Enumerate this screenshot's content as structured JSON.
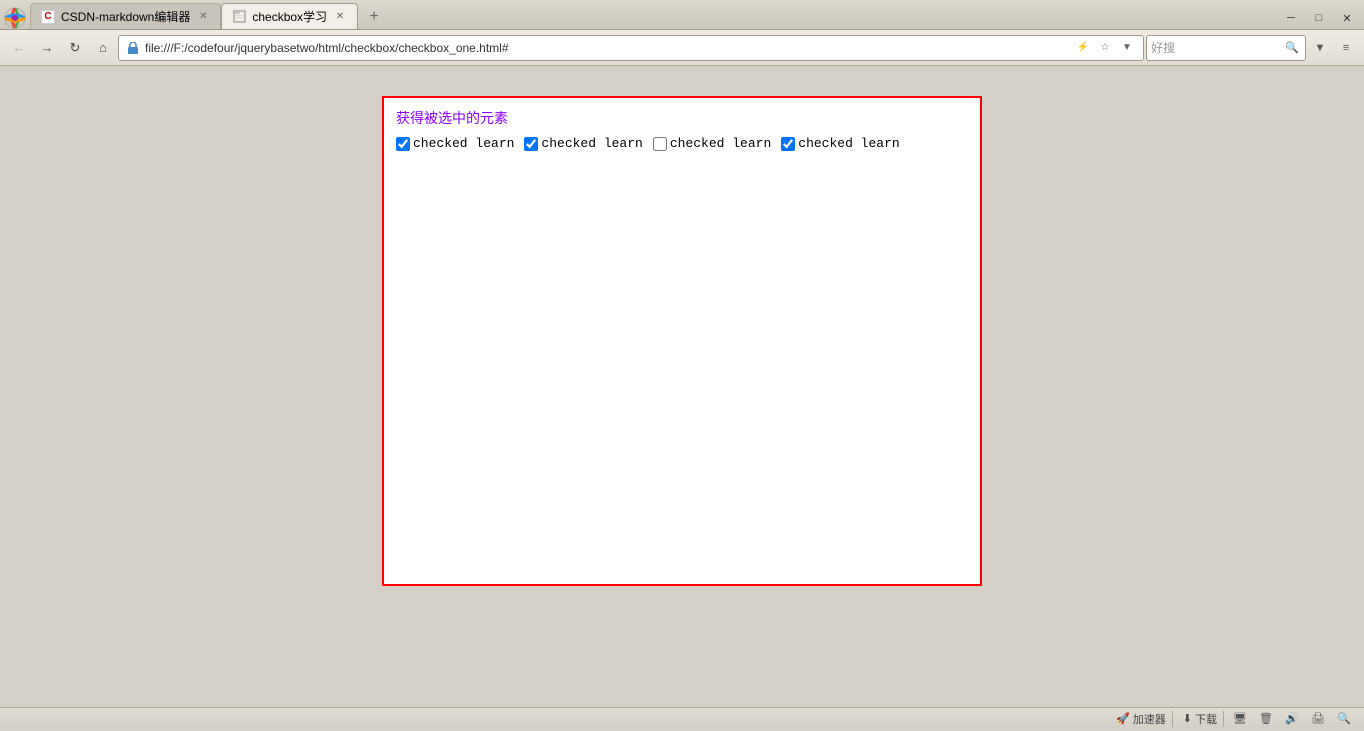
{
  "browser": {
    "title": "checkbox学习",
    "tabs": [
      {
        "id": "tab1",
        "label": "CSDN-markdown编辑器",
        "favicon": "C",
        "active": false
      },
      {
        "id": "tab2",
        "label": "checkbox学习",
        "favicon": "📄",
        "active": true
      }
    ],
    "address": "file:///F:/codefour/jquerybasetwo/html/checkbox/checkbox_one.html#",
    "search_placeholder": "好搜",
    "nav_buttons": {
      "back": "←",
      "forward": "→",
      "refresh": "↻",
      "home": "⌂",
      "bookmark": "☆",
      "history": "◷"
    }
  },
  "webpage": {
    "title": "获得被选中的元素",
    "checkboxes": [
      {
        "id": "cb1",
        "label": "checked learn",
        "checked": true
      },
      {
        "id": "cb2",
        "label": "checked learn",
        "checked": true
      },
      {
        "id": "cb3",
        "label": "checked learn",
        "checked": false
      },
      {
        "id": "cb4",
        "label": "checked learn",
        "checked": true
      }
    ]
  },
  "status_bar": {
    "items": [
      "加速器",
      "下载"
    ]
  },
  "window_controls": {
    "minimize": "─",
    "maximize": "□",
    "close": "✕"
  }
}
